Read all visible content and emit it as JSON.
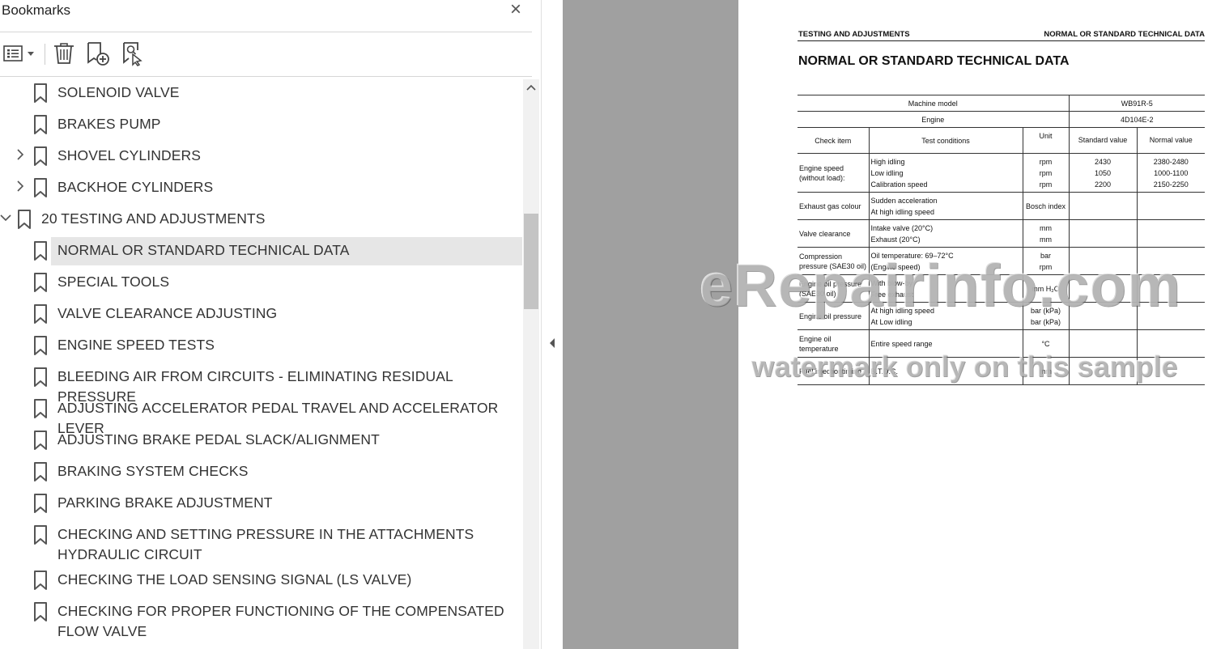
{
  "bookmarks_panel": {
    "title": "Bookmarks",
    "close_glyph": "×",
    "toolbar": [
      {
        "name": "options-menu-icon"
      },
      {
        "name": "delete-bookmark-icon"
      },
      {
        "name": "add-bookmark-icon"
      },
      {
        "name": "find-bookmark-icon"
      }
    ],
    "items": [
      {
        "label": "SOLENOID VALVE",
        "level": 1,
        "expandable": false,
        "expanded": false,
        "selected": false
      },
      {
        "label": "BRAKES PUMP",
        "level": 1,
        "expandable": false,
        "expanded": false,
        "selected": false
      },
      {
        "label": "SHOVEL CYLINDERS",
        "level": 1,
        "expandable": true,
        "expanded": false,
        "selected": false
      },
      {
        "label": "BACKHOE CYLINDERS",
        "level": 1,
        "expandable": true,
        "expanded": false,
        "selected": false
      },
      {
        "label": "20 TESTING AND ADJUSTMENTS",
        "level": 0,
        "expandable": true,
        "expanded": true,
        "selected": false
      },
      {
        "label": "NORMAL OR STANDARD TECHNICAL DATA",
        "level": 1,
        "expandable": false,
        "expanded": false,
        "selected": true
      },
      {
        "label": "SPECIAL TOOLS",
        "level": 1,
        "expandable": false,
        "expanded": false,
        "selected": false
      },
      {
        "label": "VALVE CLEARANCE ADJUSTING",
        "level": 1,
        "expandable": false,
        "expanded": false,
        "selected": false
      },
      {
        "label": "ENGINE SPEED TESTS",
        "level": 1,
        "expandable": false,
        "expanded": false,
        "selected": false
      },
      {
        "label": "BLEEDING AIR FROM CIRCUITS - ELIMINATING RESIDUAL PRESSURE",
        "level": 1,
        "expandable": false,
        "expanded": false,
        "selected": false
      },
      {
        "label": "ADJUSTING ACCELERATOR PEDAL TRAVEL AND ACCELERATOR LEVER",
        "level": 1,
        "expandable": false,
        "expanded": false,
        "selected": false
      },
      {
        "label": "ADJUSTING BRAKE PEDAL SLACK/ALIGNMENT",
        "level": 1,
        "expandable": false,
        "expanded": false,
        "selected": false
      },
      {
        "label": "BRAKING SYSTEM CHECKS",
        "level": 1,
        "expandable": false,
        "expanded": false,
        "selected": false
      },
      {
        "label": "PARKING BRAKE ADJUSTMENT",
        "level": 1,
        "expandable": false,
        "expanded": false,
        "selected": false
      },
      {
        "label": "CHECKING AND SETTING PRESSURE IN THE ATTACHMENTS HYDRAULIC CIRCUIT",
        "level": 1,
        "expandable": false,
        "expanded": false,
        "selected": false
      },
      {
        "label": "CHECKING THE LOAD SENSING SIGNAL (LS VALVE)",
        "level": 1,
        "expandable": false,
        "expanded": false,
        "selected": false
      },
      {
        "label": "CHECKING FOR PROPER FUNCTIONING OF THE COMPENSATED FLOW VALVE",
        "level": 1,
        "expandable": false,
        "expanded": false,
        "selected": false
      }
    ]
  },
  "document": {
    "header_left": "TESTING AND ADJUSTMENTS",
    "header_right": "NORMAL OR STANDARD TECHNICAL DATA",
    "title": "NORMAL OR STANDARD TECHNICAL DATA",
    "table": {
      "machine_model_label": "Machine model",
      "machine_model_value": "WB91R-5",
      "engine_label": "Engine",
      "engine_value": "4D104E-2",
      "headers": {
        "check_item": "Check item",
        "test_conditions": "Test conditions",
        "unit": "Unit",
        "standard_value": "Standard value",
        "normal_value": "Normal value"
      },
      "rows": [
        {
          "item": "Engine speed (without load):",
          "conditions": [
            "High idling",
            "Low idling",
            "Calibration speed"
          ],
          "units": [
            "rpm",
            "rpm",
            "rpm"
          ],
          "standard": [
            "2430",
            "1050",
            "2200"
          ],
          "normal": [
            "2380-2480",
            "1000-1100",
            "2150-2250"
          ]
        },
        {
          "item": "Exhaust gas colour",
          "conditions": [
            "Sudden acceleration",
            "At high idling speed"
          ],
          "units": [
            "Bosch index"
          ],
          "standard": [],
          "normal": []
        },
        {
          "item": "Valve clearance",
          "conditions": [
            "Intake valve (20°C)",
            "Exhaust (20°C)"
          ],
          "units": [
            "mm",
            "mm"
          ],
          "standard": [],
          "normal": []
        },
        {
          "item": "Compression pressure (SAE30 oil)",
          "conditions": [
            "Oil temperature: 69–72°C",
            "(Engine speed)"
          ],
          "units": [
            "bar",
            "rpm"
          ],
          "standard": [],
          "normal": []
        },
        {
          "item": "Engine oil pressure (SAE30 oil)",
          "conditions": [
            "With blow-by",
            "Free exhaust"
          ],
          "units": [
            "mm H₂O"
          ],
          "standard": [],
          "normal": []
        },
        {
          "item": "Engine oil pressure",
          "conditions": [
            "At high idling speed",
            "At Low idling"
          ],
          "units": [
            "bar (kPa)",
            "bar (kPa)"
          ],
          "standard": [],
          "normal": []
        },
        {
          "item": "Engine oil temperature",
          "conditions": [
            "Entire speed range"
          ],
          "units": [
            "°C"
          ],
          "standard": [],
          "normal": []
        },
        {
          "item": "Fuel injectiontiming",
          "conditions": [
            "B.T.D.C."
          ],
          "units": [
            "mm"
          ],
          "standard": [],
          "normal": []
        }
      ]
    },
    "watermark_main": "eRepairinfo.com",
    "watermark_sub": "watermark only on this sample"
  }
}
